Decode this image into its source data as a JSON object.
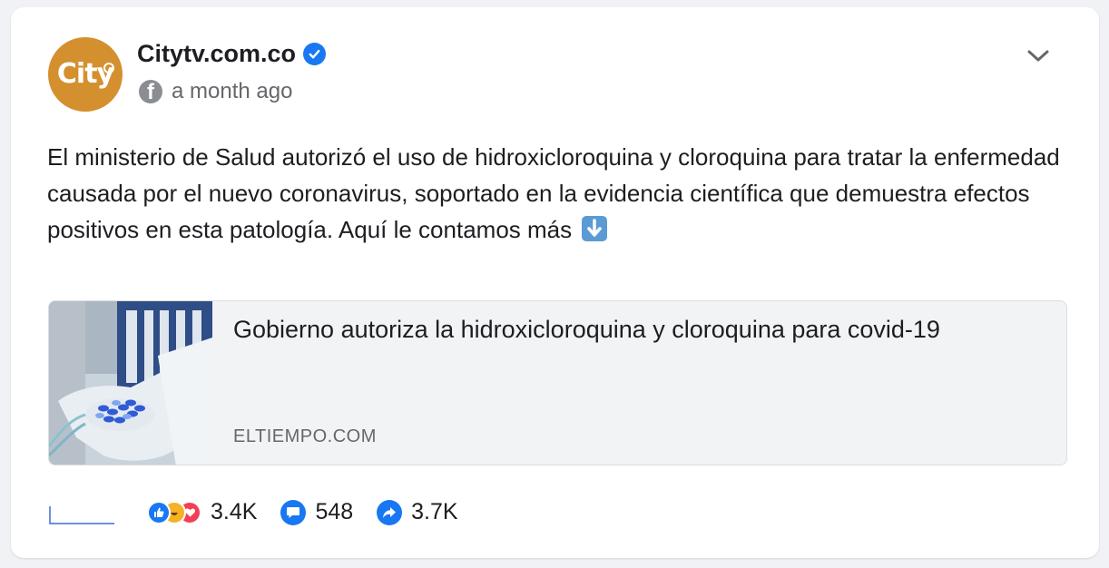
{
  "post": {
    "author": "Citytv.com.co",
    "avatar_text": "City",
    "timestamp": "a month ago",
    "text": "El ministerio de Salud autorizó el uso de hidroxicloroquina y cloroquina para tratar la enfermedad causada por el nuevo coronavirus, soportado en la evidencia científica que demuestra efectos positivos en esta patología. Aquí le contamos más",
    "icons": {
      "verified": "verified-badge-icon",
      "platform": "facebook-icon",
      "menu": "chevron-down-icon",
      "emoji": "down-arrow-emoji-icon"
    }
  },
  "link_preview": {
    "title": "Gobierno autoriza la hidroxicloroquina y cloroquina para covid-19",
    "domain": "ELTIEMPO.COM"
  },
  "engagement": {
    "reactions": "3.4K",
    "comments": "548",
    "shares": "3.7K",
    "icons": [
      "like-icon",
      "haha-icon",
      "love-icon",
      "comment-icon",
      "share-icon"
    ]
  },
  "colors": {
    "avatar_bg": "#d4902e",
    "verified": "#1877f2",
    "secondary_text": "#65676b"
  }
}
